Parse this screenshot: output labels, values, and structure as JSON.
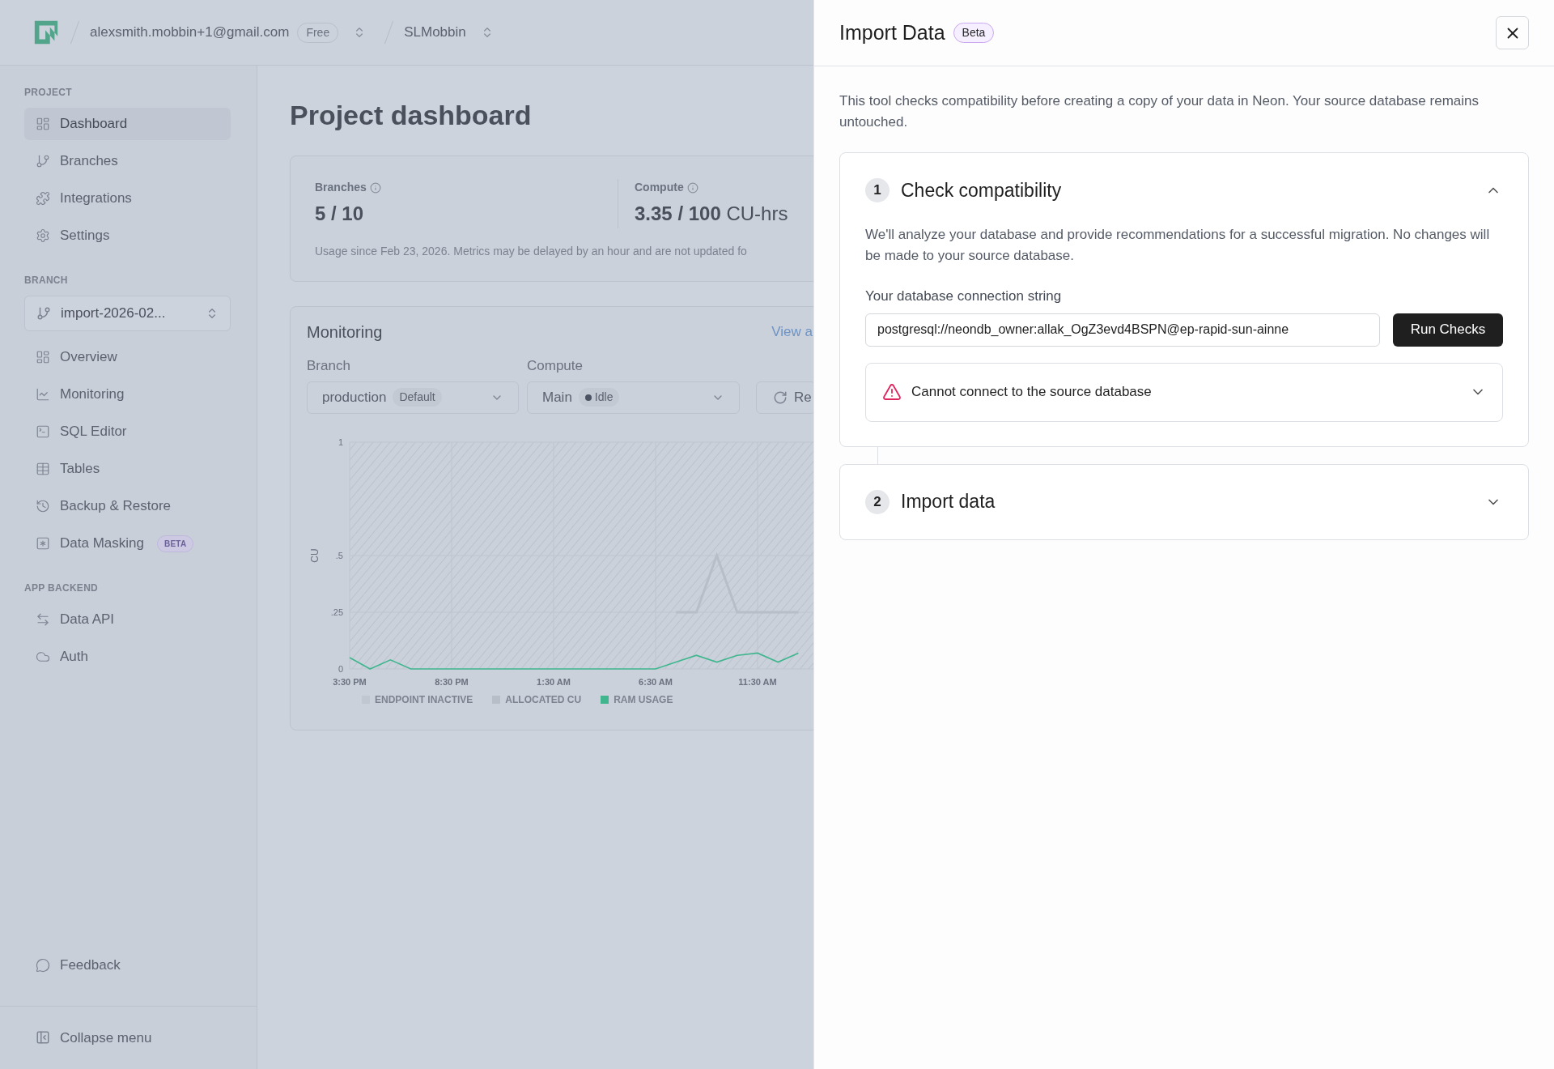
{
  "topbar": {
    "account": "alexsmith.mobbin+1@gmail.com",
    "plan": "Free",
    "project": "SLMobbin"
  },
  "sidebar": {
    "sections": [
      {
        "heading": "PROJECT",
        "items": [
          {
            "label": "Dashboard",
            "selected": true
          },
          {
            "label": "Branches",
            "selected": false
          },
          {
            "label": "Integrations",
            "selected": false
          },
          {
            "label": "Settings",
            "selected": false
          }
        ]
      },
      {
        "heading": "BRANCH",
        "branch_select": "import-2026-02...",
        "items": [
          {
            "label": "Overview",
            "selected": false
          },
          {
            "label": "Monitoring",
            "selected": false
          },
          {
            "label": "SQL Editor",
            "selected": false
          },
          {
            "label": "Tables",
            "selected": false
          },
          {
            "label": "Backup & Restore",
            "selected": false
          },
          {
            "label": "Data Masking",
            "selected": false,
            "badge": "BETA"
          }
        ]
      },
      {
        "heading": "APP BACKEND",
        "items": [
          {
            "label": "Data API",
            "selected": false
          },
          {
            "label": "Auth",
            "selected": false
          }
        ]
      }
    ],
    "footer_items": [
      {
        "label": "Feedback",
        "selected": false
      }
    ],
    "collapse": "Collapse menu"
  },
  "page": {
    "title": "Project dashboard",
    "usage": {
      "stats": [
        {
          "label": "Branches",
          "value": "**5 / 10**"
        },
        {
          "label": "Compute",
          "value": "**3.35 / 100** CU-hrs"
        }
      ],
      "note": "Usage since Feb 23, 2026. Metrics may be delayed by an hour and are not updated fo"
    },
    "monitoring": {
      "title": "Monitoring",
      "link": "View a",
      "filters": [
        {
          "kind": "branch",
          "label": "Branch",
          "value": "production",
          "badge": "Default"
        },
        {
          "kind": "compute",
          "label": "Compute",
          "value": "Main",
          "badge": "Idle"
        }
      ],
      "refresh": "Re",
      "inactive_label": "ENDPOINT INACTIVE",
      "chart_data": {
        "type": "line",
        "grid": true,
        "ylabel": "CU",
        "categories": [
          "3:30 PM",
          null,
          null,
          null,
          null,
          "8:30 PM",
          null,
          null,
          null,
          null,
          "1:30 AM",
          null,
          null,
          null,
          null,
          "6:30 AM",
          null,
          null,
          null,
          null,
          "11:30 AM",
          null,
          null
        ],
        "series": [
          {
            "name": "ALLOCATED CU",
            "color": "#b8bec8",
            "values": [
              null,
              null,
              null,
              null,
              null,
              null,
              null,
              null,
              null,
              null,
              null,
              null,
              null,
              null,
              null,
              null,
              0.25,
              0.25,
              0.5,
              0.25,
              0.25,
              0.25,
              0.25
            ]
          },
          {
            "name": "RAM USAGE",
            "color": "#3fb68e",
            "values": [
              0.05,
              0,
              0.04,
              0,
              0,
              0,
              0,
              0,
              0,
              0,
              0,
              0,
              0,
              0,
              0,
              0,
              0.03,
              0.06,
              0.03,
              0.06,
              0.07,
              0.03,
              0.07
            ]
          }
        ],
        "yticks": [
          {
            "value": 0,
            "label": "0"
          },
          {
            "value": 0.25,
            "label": ".25"
          },
          {
            "value": 0.5,
            "label": ".5"
          },
          {
            "value": 1,
            "label": "1"
          }
        ],
        "ylim": [
          0,
          1
        ]
      }
    }
  },
  "dialog": {
    "title": "Import Data",
    "badge": "Beta",
    "intro": "This tool checks compatibility before creating a copy of your data in Neon. Your source database remains untouched.",
    "steps": [
      {
        "number": "1",
        "title": "Check compatibility",
        "expanded": true,
        "description": "We'll analyze your database and provide recommendations for a successful migration. No changes will be made to your source database.",
        "field_label": "Your database connection string",
        "field_value": "postgresql://neondb_owner:allak_OgZ3evd4BSPN@ep-rapid-sun-ainne",
        "button": "Run Checks",
        "alert": {
          "message": "Cannot connect to the source database",
          "expanded": false
        }
      },
      {
        "number": "2",
        "title": "Import data",
        "expanded": false
      }
    ]
  }
}
